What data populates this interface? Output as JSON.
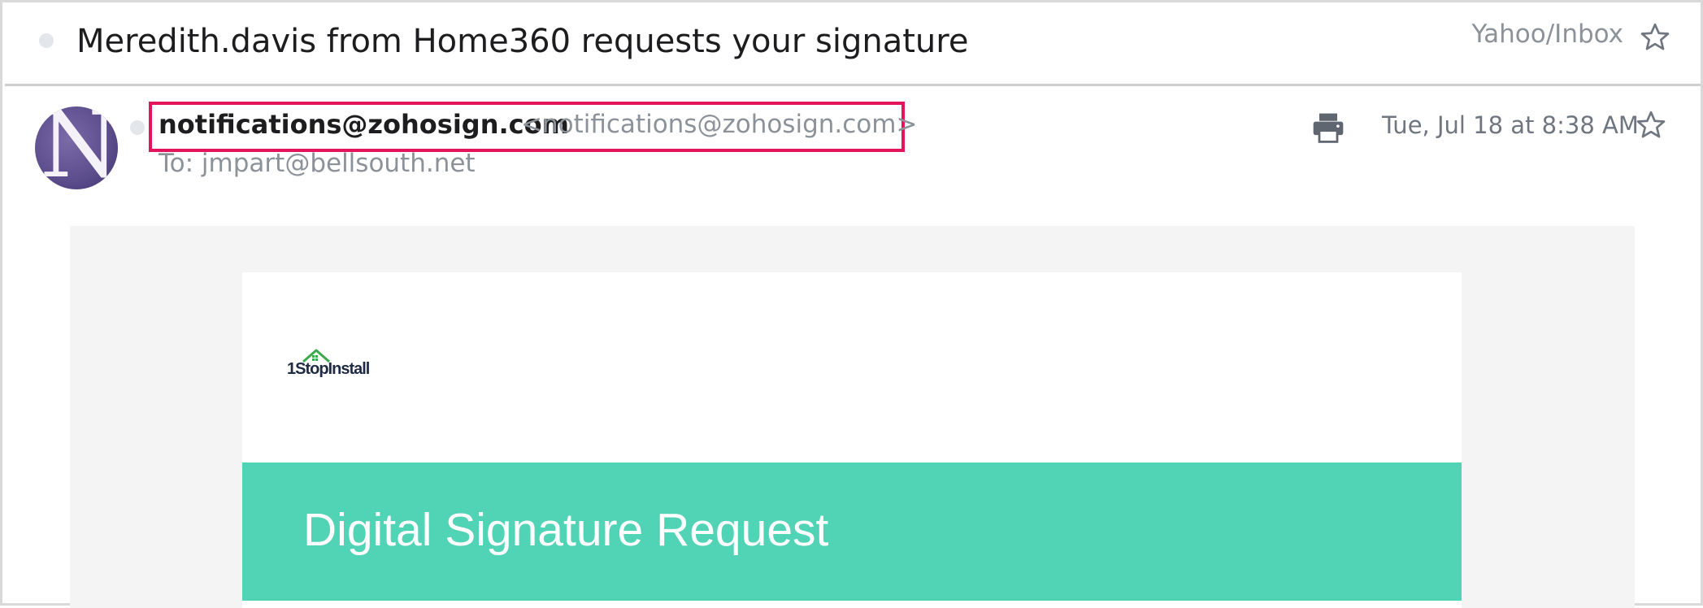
{
  "subject": {
    "title": "Meredith.davis from Home360 requests your signature",
    "folder": "Yahoo/Inbox"
  },
  "sender": {
    "avatar_letter": "N",
    "name": "notifications@zohosign.com",
    "email": "<notifications@zohosign.com>",
    "recipient": "To: jmpart@bellsouth.net",
    "date": "Tue, Jul 18 at 8:38 AM"
  },
  "icons": {
    "unread_dot": "dot-icon",
    "star": "star-icon",
    "print": "print-icon",
    "logo_house": "house-icon"
  },
  "email_body": {
    "logo_text": "1StopInstall",
    "banner_title": "Digital Signature Request"
  },
  "colors": {
    "highlight_border": "#e5135b",
    "banner_bg": "#51d3b6",
    "logo_green": "#3daa4a",
    "logo_navy": "#1f2a44"
  }
}
